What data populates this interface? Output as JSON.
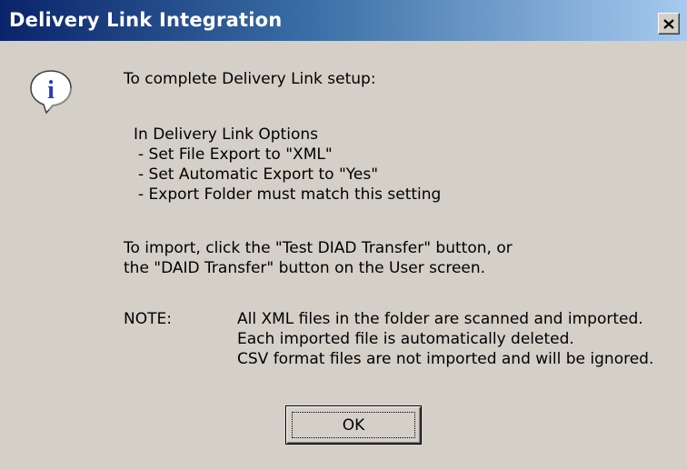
{
  "window": {
    "title": "Delivery Link Integration",
    "close_glyph": "close-icon"
  },
  "icon": {
    "name": "information-icon",
    "color": "#1f3fbf"
  },
  "message": {
    "intro": "To complete Delivery Link setup:",
    "options_heading": "In Delivery Link Options",
    "options": [
      "- Set File Export to \"XML\"",
      "- Set Automatic Export to \"Yes\"",
      "- Export Folder must match this setting"
    ],
    "import_lines": [
      "To import, click the \"Test DIAD Transfer\" button, or",
      "the \"DAID Transfer\" button on the User screen."
    ],
    "note_label": "NOTE:",
    "note_lines": [
      "All XML files in the folder are scanned and imported.",
      "Each imported file is automatically deleted.",
      "CSV format files are not imported and will be ignored."
    ]
  },
  "buttons": {
    "ok_label": "OK"
  }
}
